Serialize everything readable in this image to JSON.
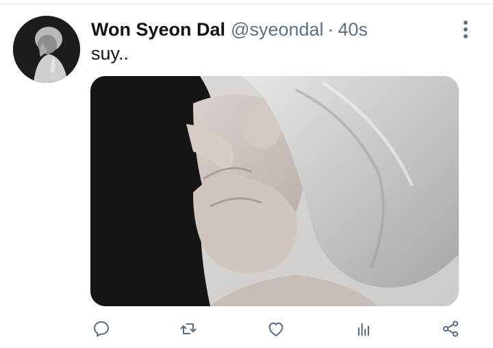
{
  "tweet": {
    "display_name": "Won Syeon Dal",
    "handle": "@syeondal",
    "separator": "·",
    "timestamp": "40s",
    "text": "suy..",
    "has_media": true
  },
  "actions": {
    "reply_icon": "reply-icon",
    "retweet_icon": "retweet-icon",
    "like_icon": "heart-icon",
    "analytics_icon": "bar-chart-icon",
    "share_icon": "share-icon"
  },
  "colors": {
    "primary_text": "#0f1419",
    "secondary_text": "#5b7083",
    "background": "#ffffff"
  }
}
